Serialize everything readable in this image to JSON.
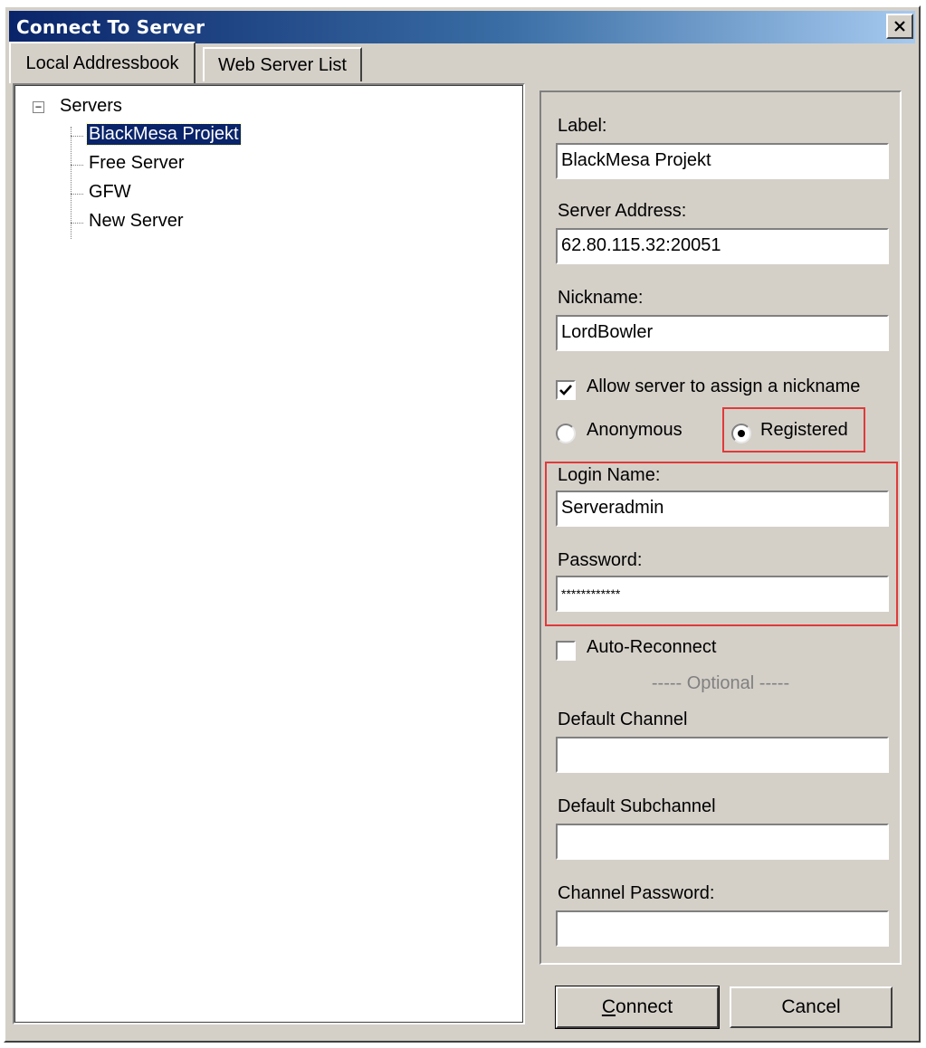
{
  "window": {
    "title": "Connect To Server"
  },
  "tabs": [
    {
      "label": "Local Addressbook",
      "active": true
    },
    {
      "label": "Web Server List",
      "active": false
    }
  ],
  "tree": {
    "root": {
      "label": "Servers",
      "expander": "−"
    },
    "items": [
      {
        "label": "BlackMesa Projekt",
        "selected": true
      },
      {
        "label": "Free Server",
        "selected": false
      },
      {
        "label": "GFW",
        "selected": false
      },
      {
        "label": "New Server",
        "selected": false
      }
    ]
  },
  "form": {
    "label_label": "Label:",
    "label_value": "BlackMesa Projekt",
    "address_label": "Server Address:",
    "address_value": "62.80.115.32:20051",
    "nickname_label": "Nickname:",
    "nickname_value": "LordBowler",
    "allow_assign_label": "Allow server to assign a nickname",
    "allow_assign_checked": true,
    "anonymous_label": "Anonymous",
    "registered_label": "Registered",
    "selected_auth": "Registered",
    "login_label": "Login Name:",
    "login_value": "Serveradmin",
    "password_label": "Password:",
    "password_value": "************",
    "auto_reconnect_label": "Auto-Reconnect",
    "auto_reconnect_checked": false,
    "optional_label": "----- Optional -----",
    "default_channel_label": "Default Channel",
    "default_channel_value": "",
    "default_subchannel_label": "Default Subchannel",
    "default_subchannel_value": "",
    "channel_password_label": "Channel Password:",
    "channel_password_value": ""
  },
  "buttons": {
    "connect_mnemonic": "C",
    "connect_rest": "onnect",
    "cancel": "Cancel"
  },
  "colors": {
    "highlight_box": "#e03a3a",
    "selection": "#0a246a",
    "face": "#d4d0c8"
  }
}
